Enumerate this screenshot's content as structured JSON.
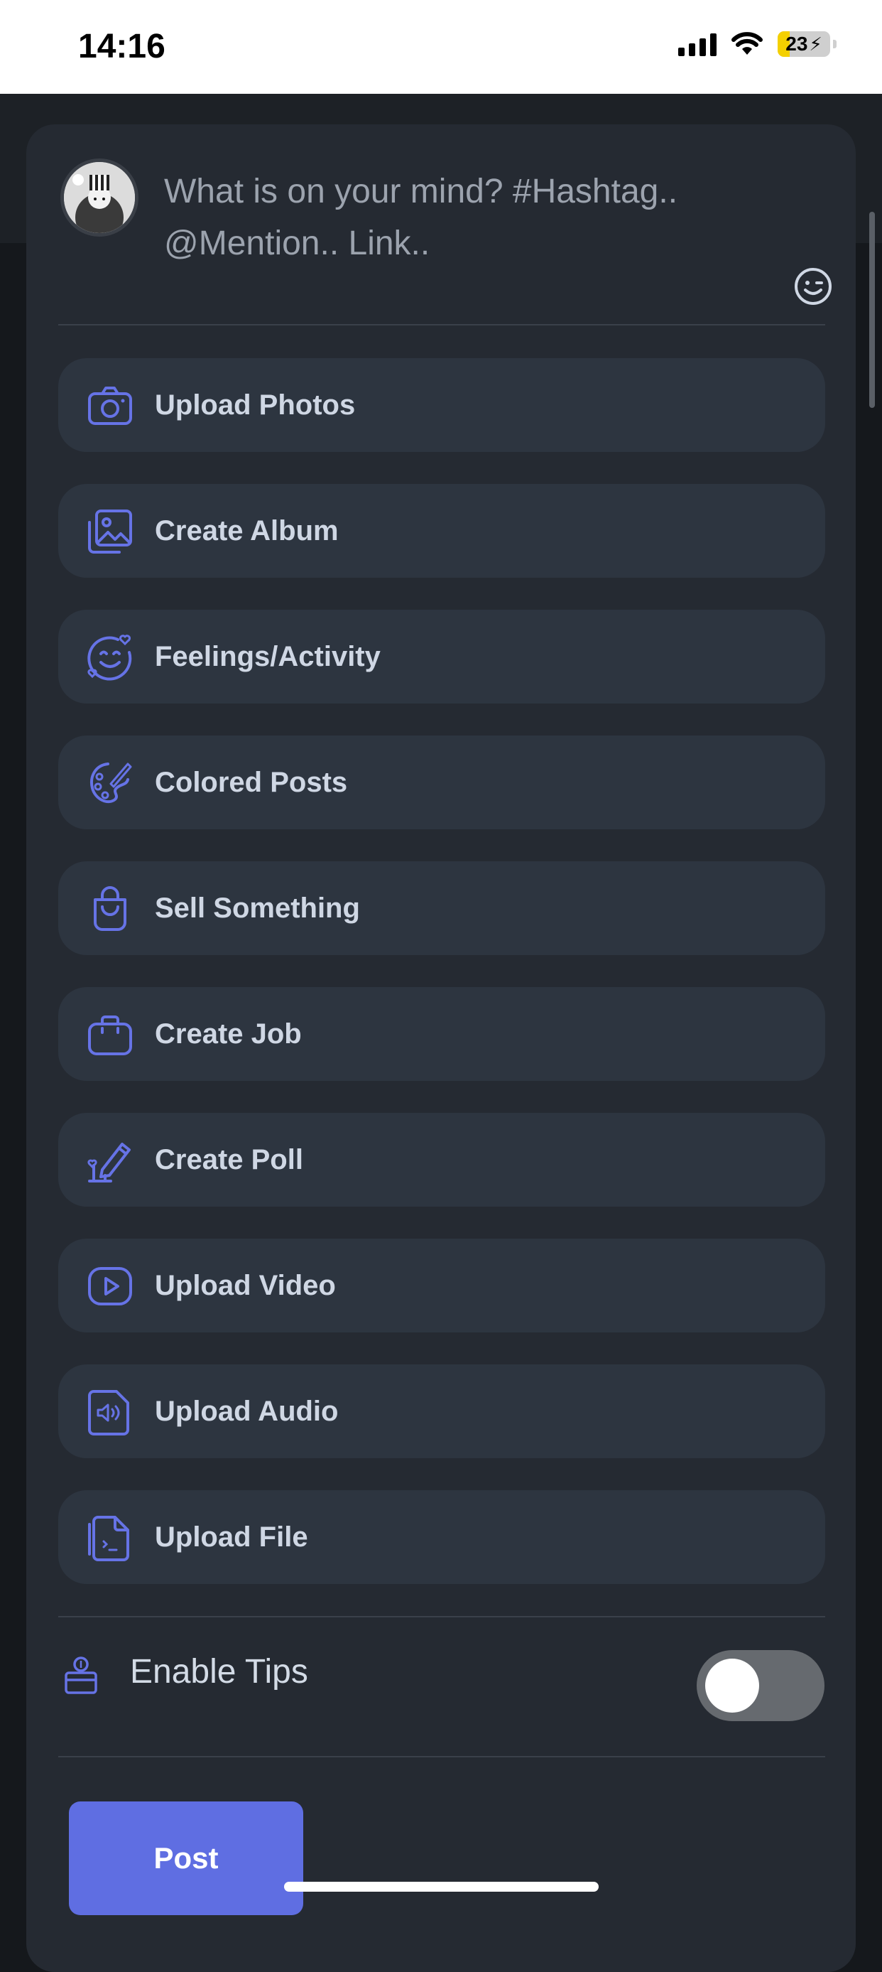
{
  "status_bar": {
    "time": "14:16",
    "battery": "23",
    "battery_percent": 23
  },
  "composer": {
    "placeholder": "What is on your mind? #Hashtag.. @Mention.. Link.."
  },
  "actions": [
    {
      "label": "Upload Photos",
      "icon": "camera-icon"
    },
    {
      "label": "Create Album",
      "icon": "image-gallery-icon"
    },
    {
      "label": "Feelings/Activity",
      "icon": "smile-heart-icon"
    },
    {
      "label": "Colored Posts",
      "icon": "palette-icon"
    },
    {
      "label": "Sell Something",
      "icon": "shopping-bag-icon"
    },
    {
      "label": "Create Job",
      "icon": "briefcase-icon"
    },
    {
      "label": "Create Poll",
      "icon": "poll-pen-icon"
    },
    {
      "label": "Upload Video",
      "icon": "video-play-icon"
    },
    {
      "label": "Upload Audio",
      "icon": "audio-file-icon"
    },
    {
      "label": "Upload File",
      "icon": "file-icon"
    }
  ],
  "tips": {
    "label": "Enable Tips",
    "enabled": false
  },
  "post_button": {
    "label": "Post"
  },
  "colors": {
    "accent": "#5f6ee2",
    "icon": "#6673e6",
    "card": "#252a32",
    "item": "#2d3540",
    "label": "#cfd7e4"
  }
}
